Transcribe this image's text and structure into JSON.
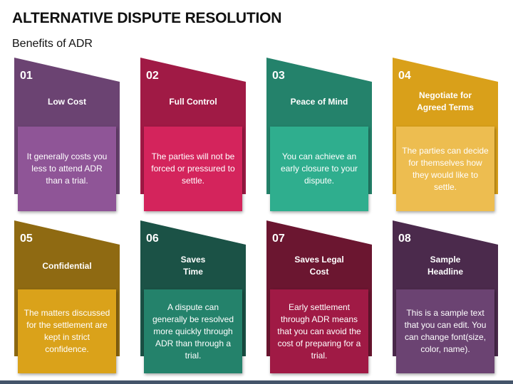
{
  "title": "ALTERNATIVE DISPUTE RESOLUTION",
  "subtitle": "Benefits of ADR",
  "cards": [
    {
      "number": "01",
      "heading": "Low Cost",
      "text": "It generally costs you less to attend ADR than a trial.",
      "dark": "#6b4372",
      "light": "#8f5597"
    },
    {
      "number": "02",
      "heading": "Full Control",
      "text": "The parties will not be forced or pressured to settle.",
      "dark": "#a01a45",
      "light": "#d4245c"
    },
    {
      "number": "03",
      "heading": "Peace of Mind",
      "text": "You can achieve an early closure to your dispute.",
      "dark": "#24826b",
      "light": "#2fae8e"
    },
    {
      "number": "04",
      "heading": "Negotiate for Agreed Terms",
      "text": "The parties can decide for themselves how they would like to settle.",
      "dark": "#d9a01a",
      "light": "#edbd50"
    },
    {
      "number": "05",
      "heading": "Confidential",
      "text": "The matters discussed for the settlement are kept in strict confidence.",
      "dark": "#8f6a12",
      "light": "#daa21a"
    },
    {
      "number": "06",
      "heading": "Saves Time",
      "text": "A dispute can generally be resolved more quickly through ADR than through a trial.",
      "dark": "#1b5246",
      "light": "#24826b"
    },
    {
      "number": "07",
      "heading": "Saves Legal Cost",
      "text": "Early settlement through ADR means that you can avoid the cost of preparing for a trial.",
      "dark": "#6b1630",
      "light": "#a01a45"
    },
    {
      "number": "08",
      "heading": "Sample Headline",
      "text": "This is a sample text that you can edit. You can change font(size, color, name).",
      "dark": "#4b2a4c",
      "light": "#6b4372"
    }
  ]
}
